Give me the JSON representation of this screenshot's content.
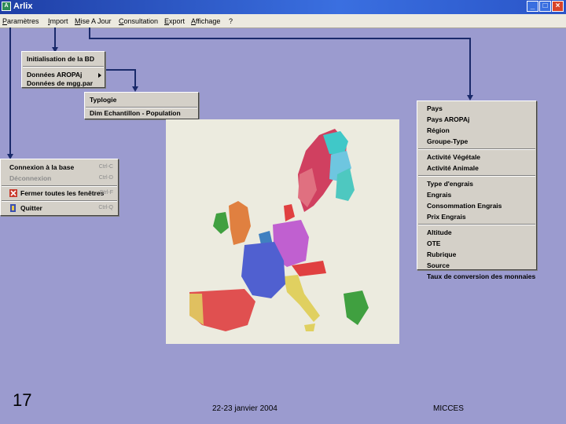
{
  "window": {
    "title": "Arlix",
    "controls": [
      "minimize",
      "maximize",
      "close"
    ]
  },
  "menubar": {
    "items": [
      "Paramètres",
      "Import",
      "Mise A Jour",
      "Consultation",
      "Export",
      "Affichage",
      "?"
    ]
  },
  "import_menu": {
    "items": [
      "Initialisation de la BD",
      "Données AROPAj",
      "Données de mgg.par"
    ]
  },
  "submenu_aropaj": {
    "items": [
      "Typlogie",
      "Dim Echantillon - Population"
    ]
  },
  "parametres_menu": {
    "connexion": {
      "label": "Connexion à la base",
      "shortcut": "Ctrl-C"
    },
    "deconnexion": {
      "label": "Déconnexion",
      "shortcut": "Ctrl-D"
    },
    "fermer": {
      "label": "Fermer toutes les fenêtres",
      "shortcut": "Ctrl-F"
    },
    "quitter": {
      "label": "Quitter",
      "shortcut": "Ctrl-Q"
    }
  },
  "miseajour_menu": {
    "group1": [
      "Pays",
      "Pays AROPAj",
      "Région",
      "Groupe-Type"
    ],
    "group2": [
      "Activité Végétale",
      "Activité Animale"
    ],
    "group3": [
      "Type d'engrais",
      "Engrais",
      "Consommation Engrais",
      "Prix Engrais"
    ],
    "group4": [
      "Altitude",
      "OTE",
      "Rubrique",
      "Source",
      "Taux de conversion des monnaies"
    ]
  },
  "map": {
    "description_icon": "europe-regions-map"
  },
  "footer": {
    "slide_number": "17",
    "date": "22-23 janvier 2004",
    "brand": "MICCES"
  }
}
